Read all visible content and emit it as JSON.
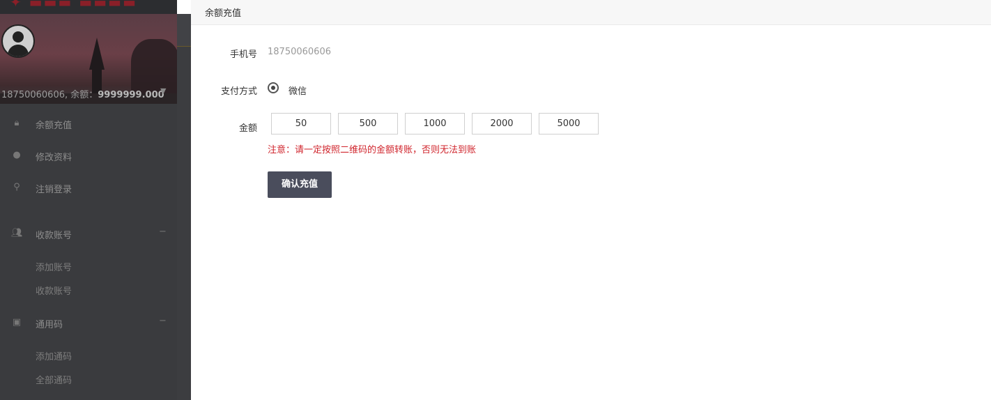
{
  "sidebar": {
    "account_phone": "18750060606",
    "balance_label": "余额：",
    "balance_value": "9999999.000",
    "menu": [
      {
        "label": "余额充值",
        "icon": "lock-icon"
      },
      {
        "label": "修改资料",
        "icon": "user-icon"
      },
      {
        "label": "注销登录",
        "icon": "walk-icon"
      }
    ],
    "groups": [
      {
        "label": "收款账号",
        "icon": "people-icon",
        "toggle": "−",
        "items": [
          "添加账号",
          "收款账号"
        ]
      },
      {
        "label": "通用码",
        "icon": "card-icon",
        "toggle": "−",
        "items": [
          "添加通码",
          "全部通码"
        ]
      }
    ]
  },
  "modal": {
    "title": "余额充值",
    "phone_label": "手机号",
    "phone_value": "18750060606",
    "payment_label": "支付方式",
    "payment_option": "微信",
    "amount_label": "金额",
    "amounts": [
      "50",
      "500",
      "1000",
      "2000",
      "5000"
    ],
    "notice": "注意：请一定按照二维码的金额转账，否则无法到账",
    "confirm_label": "确认充值"
  }
}
